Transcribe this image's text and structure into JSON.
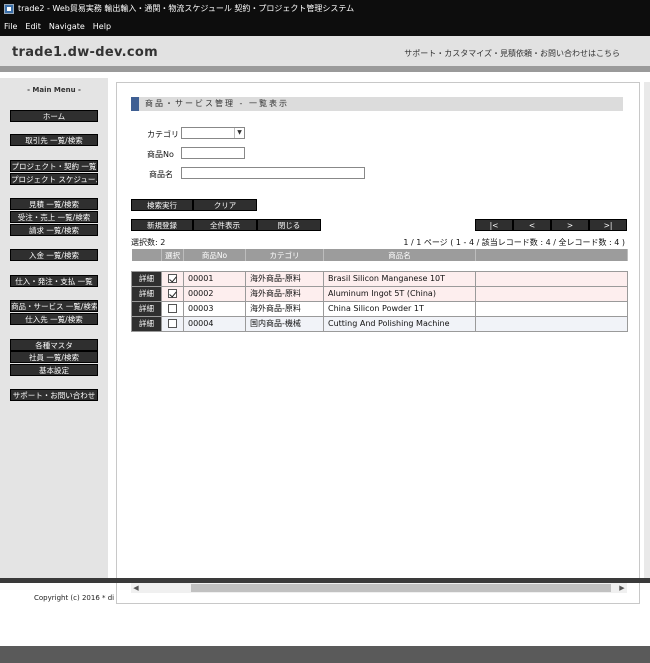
{
  "window": {
    "title": "trade2 - Web貿易実務 輸出輸入・通関・物流スケジュール 契約・プロジェクト管理システム"
  },
  "menubar": {
    "items": [
      "File",
      "Edit",
      "Navigate",
      "Help"
    ]
  },
  "header": {
    "domain": "trade1.dw-dev.com",
    "support": "サポート・カスタマイズ・見積依頼・お問い合わせはこちら"
  },
  "sidebar": {
    "title": "- Main Menu -",
    "items": [
      "ホーム",
      "取引先 一覧/検索",
      "プロジェクト・契約 一覧",
      "プロジェクト スケジュール",
      "見積 一覧/検索",
      "受注・売上 一覧/検索",
      "請求 一覧/検索",
      "入金 一覧/検索",
      "仕入・発注・支払 一覧",
      "商品・サービス 一覧/検索",
      "仕入先 一覧/検索",
      "各種マスタ",
      "社員 一覧/検索",
      "基本設定",
      "サポート・お問い合わせ"
    ]
  },
  "main": {
    "section_title": "商品・サービス管理 - 一覧表示",
    "form": {
      "category_label": "カテゴリ",
      "category_value": "",
      "code_label": "商品No",
      "code_value": "",
      "name_label": "商品名",
      "name_value": ""
    },
    "buttons": {
      "search": "検索実行",
      "clear": "クリア",
      "new": "新規登録",
      "show_all": "全件表示",
      "close": "閉じる",
      "first": "|<",
      "prev": "<",
      "next": ">",
      "last": ">|"
    },
    "selected_count": "選択数: 2",
    "page_info": "1 / 1 ページ ( 1 - 4 / 該当レコード数 : 4 / 全レコード数 : 4 )",
    "table": {
      "headers": [
        "",
        "選択",
        "商品No",
        "カテゴリ",
        "商品名",
        ""
      ],
      "detail_label": "詳細",
      "rows": [
        {
          "checked": true,
          "code": "00001",
          "category": "海外商品-原料",
          "name": "Brasil Silicon Manganese 10T"
        },
        {
          "checked": true,
          "code": "00002",
          "category": "海外商品-原料",
          "name": "Aluminum Ingot 5T (China)"
        },
        {
          "checked": false,
          "code": "00003",
          "category": "海外商品-原料",
          "name": "China Silicon Powder 1T"
        },
        {
          "checked": false,
          "code": "00004",
          "category": "国内商品-機械",
          "name": "Cutting And Polishing Machine"
        }
      ]
    }
  },
  "footer": {
    "copyright": "Copyright (c) 2016 * di"
  }
}
